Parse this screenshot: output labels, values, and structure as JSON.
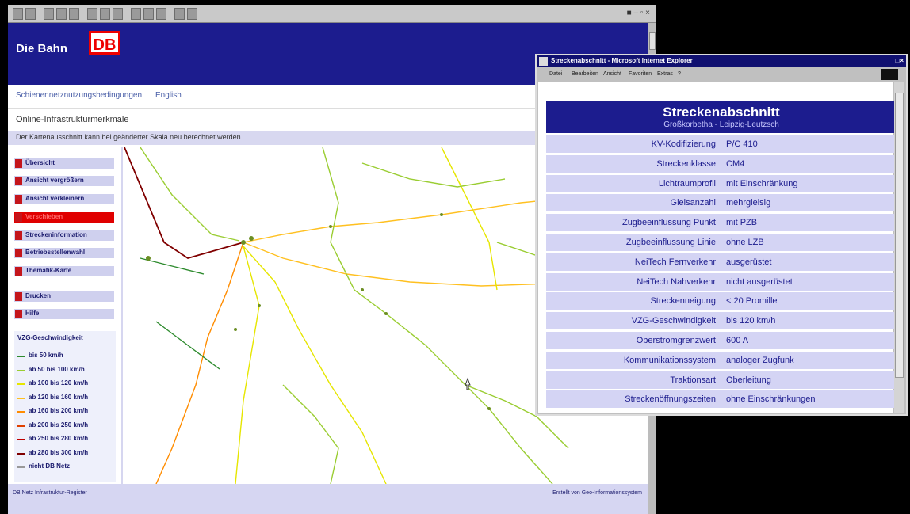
{
  "main_window": {
    "brand": "Die Bahn",
    "logo": "DB",
    "nav_links": [
      "Schienennetznutzungsbedingungen",
      "English"
    ],
    "section_title": "Online-Infrastrukturmerkmale",
    "notice": "Der Kartenausschnitt kann bei geänderter Skala neu berechnet werden.",
    "sidebar_items": [
      {
        "label": "Übersicht",
        "active": false
      },
      {
        "label": "Ansicht vergrößern",
        "active": false
      },
      {
        "label": "Ansicht verkleinern",
        "active": false
      },
      {
        "label": "Verschieben",
        "active": true
      },
      {
        "label": "Streckeninformation",
        "active": false
      },
      {
        "label": "Betriebsstellenwahl",
        "active": false
      },
      {
        "label": "Thematik-Karte",
        "active": false
      },
      {
        "label": "Drucken",
        "active": false
      },
      {
        "label": "Hilfe",
        "active": false
      }
    ],
    "legend": {
      "title": "VZG-Geschwindigkeit",
      "rows": [
        {
          "label": "bis 50 km/h",
          "color": "#2e8b2e"
        },
        {
          "label": "ab 50 bis 100 km/h",
          "color": "#9acd32"
        },
        {
          "label": "ab 100 bis 120 km/h",
          "color": "#e6e600"
        },
        {
          "label": "ab 120 bis 160 km/h",
          "color": "#ffc020"
        },
        {
          "label": "ab 160 bis 200 km/h",
          "color": "#ff8c00"
        },
        {
          "label": "ab 200 bis 250 km/h",
          "color": "#e04000"
        },
        {
          "label": "ab 250 bis 280 km/h",
          "color": "#c00000"
        },
        {
          "label": "ab 280 bis 300 km/h",
          "color": "#800000"
        },
        {
          "label": "nicht DB Netz",
          "color": "#999999"
        }
      ]
    },
    "footer_left": "DB Netz Infrastruktur-Register",
    "footer_right": "Erstellt von Geo-Informationssystem"
  },
  "popup": {
    "window_title": "Streckenabschnitt - Microsoft Internet Explorer",
    "menu": [
      "Datei",
      "Bearbeiten",
      "Ansicht",
      "Favoriten",
      "Extras",
      "?"
    ],
    "heading": "Streckenabschnitt",
    "subheading": "Großkorbetha - Leipzig-Leutzsch",
    "rows": [
      {
        "key": "KV-Kodifizierung",
        "value": "P/C 410"
      },
      {
        "key": "Streckenklasse",
        "value": "CM4"
      },
      {
        "key": "Lichtraumprofil",
        "value": "mit Einschränkung"
      },
      {
        "key": "Gleisanzahl",
        "value": "mehrgleisig"
      },
      {
        "key": "Zugbeeinflussung Punkt",
        "value": "mit PZB"
      },
      {
        "key": "Zugbeeinflussung Linie",
        "value": "ohne LZB"
      },
      {
        "key": "NeiTech Fernverkehr",
        "value": "ausgerüstet"
      },
      {
        "key": "NeiTech Nahverkehr",
        "value": "nicht ausgerüstet"
      },
      {
        "key": "Streckenneigung",
        "value": "< 20 Promille"
      },
      {
        "key": "VZG-Geschwindigkeit",
        "value": "bis 120 km/h"
      },
      {
        "key": "Oberstromgrenzwert",
        "value": "600 A"
      },
      {
        "key": "Kommunikationssystem",
        "value": "analoger Zugfunk"
      },
      {
        "key": "Traktionsart",
        "value": "Oberleitung"
      },
      {
        "key": "Streckenöffnungszeiten",
        "value": "ohne Einschränkungen"
      }
    ]
  }
}
